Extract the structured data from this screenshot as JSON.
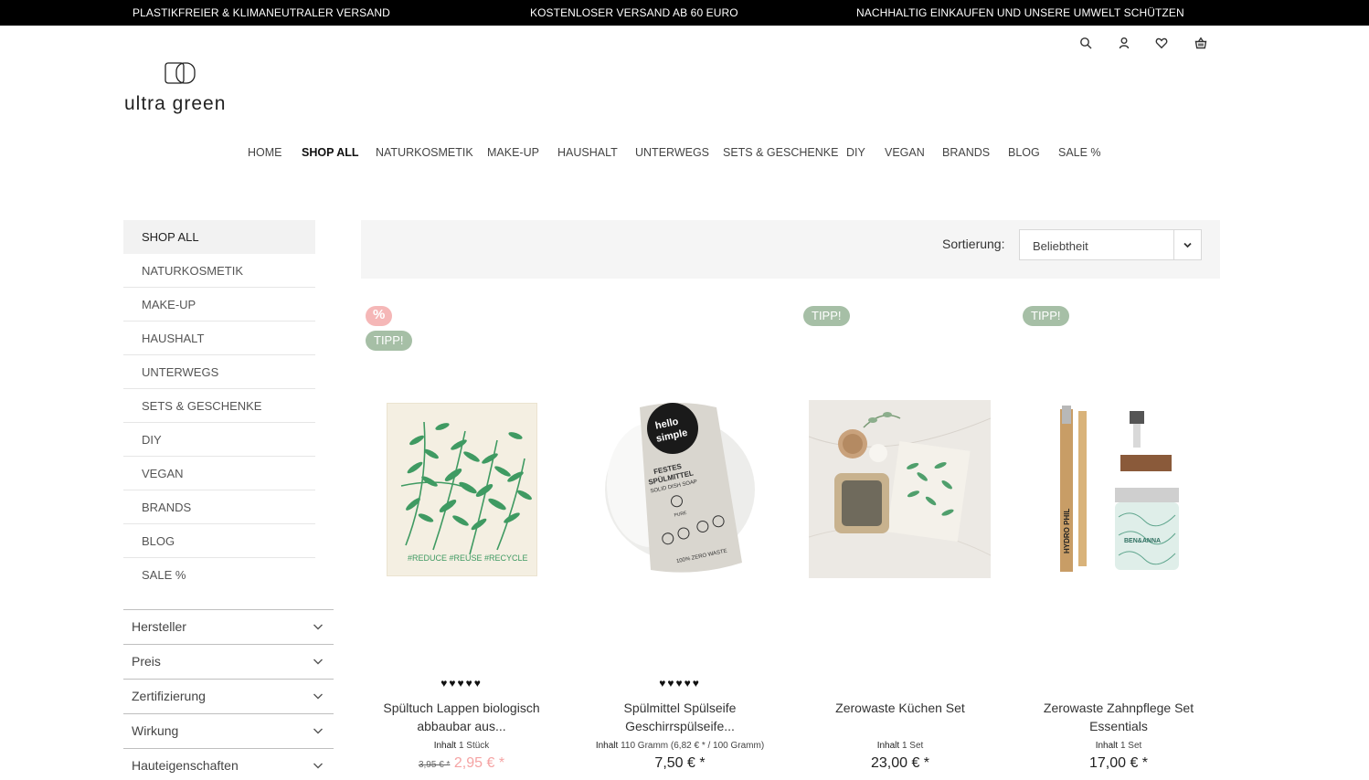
{
  "topbar": {
    "msg1": "PLASTIKFREIER & KLIMANEUTRALER VERSAND",
    "msg2": "KOSTENLOSER VERSAND AB 60 EURO",
    "msg3": "NACHHALTIG EINKAUFEN UND UNSERE UMWELT SCHÜTZEN"
  },
  "header": {
    "logo_text": "ultra green",
    "icons": [
      "search-icon",
      "account-icon",
      "heart-icon",
      "basket-icon"
    ]
  },
  "nav": {
    "items": [
      "HOME",
      "SHOP ALL",
      "NATURKOSMETIK",
      "MAKE-UP",
      "HAUSHALT",
      "UNTERWEGS",
      "SETS & GESCHENKE",
      "DIY",
      "VEGAN",
      "BRANDS",
      "BLOG",
      "SALE %"
    ],
    "active": "SHOP ALL"
  },
  "sidebar": {
    "items": [
      "SHOP ALL",
      "NATURKOSMETIK",
      "MAKE-UP",
      "HAUSHALT",
      "UNTERWEGS",
      "SETS & GESCHENKE",
      "DIY",
      "VEGAN",
      "BRANDS",
      "BLOG",
      "SALE %"
    ],
    "active": "SHOP ALL"
  },
  "filters": [
    "Hersteller",
    "Preis",
    "Zertifizierung",
    "Wirkung",
    "Hauteigenschaften"
  ],
  "sort": {
    "label": "Sortierung:",
    "value": "Beliebtheit"
  },
  "products": [
    {
      "badges": [
        "%",
        "TIPP!"
      ],
      "rating": 5,
      "stars": "♥♥♥♥♥",
      "name_line1": "Spültuch Lappen biologisch",
      "name_line2": "abbaubar aus...",
      "inhalt_label": "Inhalt",
      "inhalt_value": "1 Stück",
      "old_price": "3,95 € *",
      "price": "2,95 € *"
    },
    {
      "badges": [],
      "rating": 5,
      "stars": "♥♥♥♥♥",
      "name_line1": "Spülmittel Spülseife",
      "name_line2": "Geschirrspülseife...",
      "inhalt_label": "Inhalt",
      "inhalt_value": "110 Gramm (6,82 € * / 100 Gramm)",
      "price": "7,50 € *",
      "image_text": {
        "label_top": "hello",
        "label_bottom": "simple",
        "line1": "FESTES",
        "line2": "SPÜLMITTEL",
        "line3": "SOLID DISH SOAP",
        "line4": "PURE",
        "line5": "100% ZERO WASTE"
      }
    },
    {
      "badges": [
        "TIPP!"
      ],
      "name_line1": "Zerowaste Küchen Set",
      "inhalt_label": "Inhalt",
      "inhalt_value": "1 Set",
      "price": "23,00 € *"
    },
    {
      "badges": [
        "TIPP!"
      ],
      "name_line1": "Zerowaste Zahnpflege Set",
      "name_line2": "Essentials",
      "inhalt_label": "Inhalt",
      "inhalt_value": "1 Set",
      "price": "17,00 € *",
      "image_text": {
        "brush_brand": "HYDRO PHIL",
        "jar_brand": "BEN&ANNA"
      }
    }
  ],
  "product1_image_text": "#REDUCE  #REUSE  #RECYCLE",
  "colors": {
    "topbar_bg": "#000000",
    "badge_tip": "#a6bfa6",
    "badge_sale": "#f5b7b7",
    "sale_price": "#f5a3a3",
    "fern_green": "#3f9a62"
  }
}
